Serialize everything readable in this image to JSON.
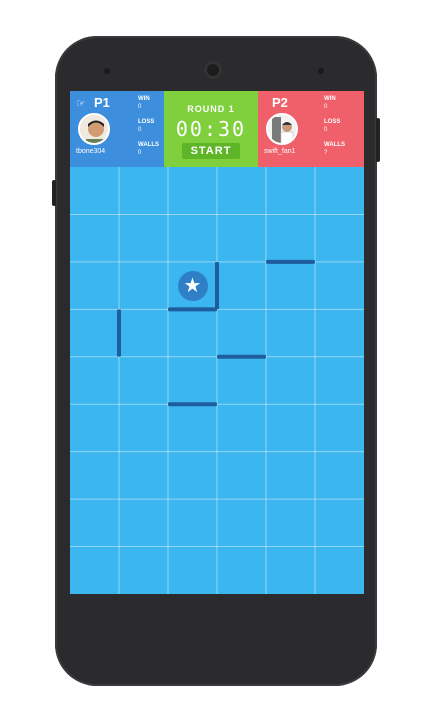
{
  "player1": {
    "label": "P1",
    "username": "tbone304",
    "stats": {
      "win_label": "WIN",
      "win": "0",
      "loss_label": "LOSS",
      "loss": "0",
      "walls_label": "WALLS",
      "walls": "0"
    },
    "color": "#3d8fde"
  },
  "player2": {
    "label": "P2",
    "username": "swift_fan1",
    "stats": {
      "win_label": "WIN",
      "win": "0",
      "loss_label": "LOSS",
      "loss": "0",
      "walls_label": "WALLS",
      "walls": "?"
    },
    "color": "#f0606a"
  },
  "center": {
    "round": "ROUND 1",
    "timer": "00:30",
    "start_label": "START",
    "color": "#7fd03c"
  },
  "board": {
    "cols": 6,
    "rows": 9,
    "background": "#3bb6ee",
    "wall_color": "#1e5e9e",
    "piece_icon": "star-icon",
    "piece_cell": [
      2,
      2
    ],
    "walls": [
      {
        "orientation": "h",
        "col": 4,
        "row": 2,
        "length": 1
      },
      {
        "orientation": "v",
        "col": 3,
        "row": 2,
        "length": 1
      },
      {
        "orientation": "h",
        "col": 2,
        "row": 3,
        "length": 1
      },
      {
        "orientation": "v",
        "col": 1,
        "row": 3,
        "length": 1
      },
      {
        "orientation": "h",
        "col": 3,
        "row": 4,
        "length": 1
      },
      {
        "orientation": "h",
        "col": 2,
        "row": 5,
        "length": 1
      }
    ]
  }
}
